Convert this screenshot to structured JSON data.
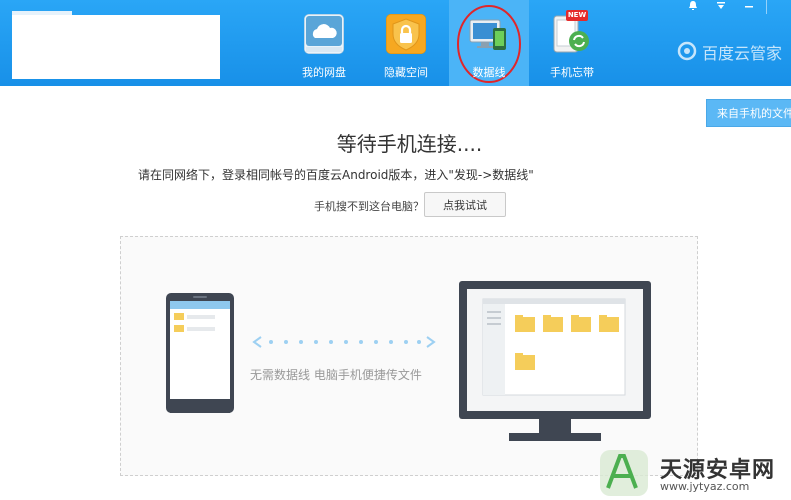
{
  "nav": {
    "items": [
      {
        "label": "我的网盘",
        "icon": "cloud-drive-icon"
      },
      {
        "label": "隐藏空间",
        "icon": "lock-icon"
      },
      {
        "label": "数据线",
        "icon": "data-cable-icon",
        "active": true
      },
      {
        "label": "手机忘带",
        "icon": "phone-sync-icon",
        "badge": "NEW"
      }
    ],
    "brand": "百度云管家"
  },
  "window_controls": [
    "bell-icon",
    "dropdown-icon",
    "minimize-icon"
  ],
  "from_phone_button": "来自手机的文件",
  "main": {
    "title": "等待手机连接....",
    "instruction": "请在同网络下，登录相同帐号的百度云Android版本，进入\"发现->数据线\"",
    "help_text": "手机搜不到这台电脑？",
    "try_button": "点我试试",
    "caption": "无需数据线 电脑手机便捷传文件"
  },
  "watermark": {
    "name": "天源安卓网",
    "url": "www.jytyaz.com"
  },
  "colors": {
    "topbar": "#1d9bf0",
    "active_tab": "#4bb4f7",
    "folder": "#f5cd5a",
    "device": "#3f4652",
    "annotation_circle": "#e0262a"
  }
}
